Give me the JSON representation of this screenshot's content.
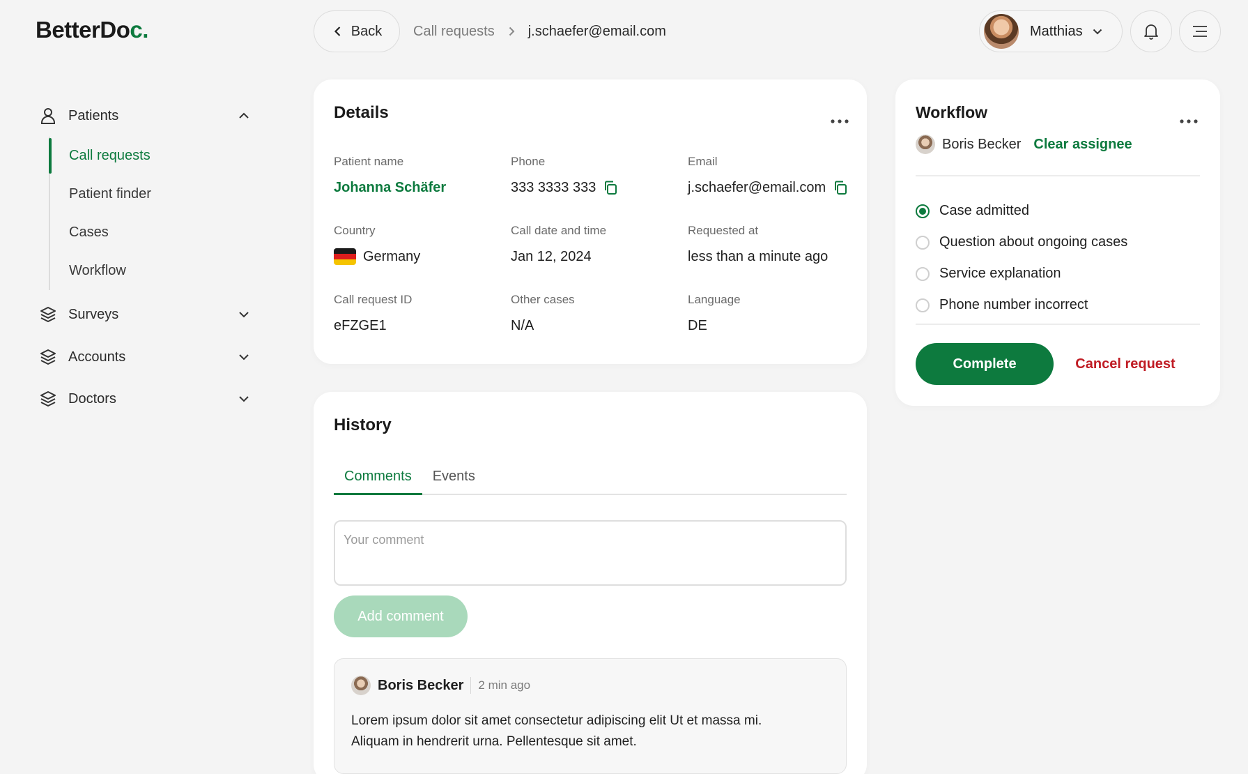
{
  "logo": {
    "text_main": "BetterDo",
    "text_accent": "c."
  },
  "topbar": {
    "back_label": "Back",
    "breadcrumb": {
      "parent": "Call requests",
      "current": "j.schaefer@email.com"
    },
    "user_name": "Matthias"
  },
  "sidebar": {
    "patients": {
      "label": "Patients",
      "items": [
        {
          "label": "Call requests",
          "active": true
        },
        {
          "label": "Patient finder"
        },
        {
          "label": "Cases"
        },
        {
          "label": "Workflow"
        }
      ]
    },
    "groups": [
      {
        "label": "Surveys"
      },
      {
        "label": "Accounts"
      },
      {
        "label": "Doctors"
      }
    ]
  },
  "details": {
    "title": "Details",
    "patient_name": {
      "label": "Patient name",
      "value": "Johanna Schäfer"
    },
    "phone": {
      "label": "Phone",
      "value": "333 3333 333"
    },
    "email": {
      "label": "Email",
      "value": "j.schaefer@email.com"
    },
    "country": {
      "label": "Country",
      "value": "Germany"
    },
    "call_date": {
      "label": "Call date and time",
      "value": "Jan 12, 2024"
    },
    "requested_at": {
      "label": "Requested at",
      "value": "less than a minute ago"
    },
    "call_request_id": {
      "label": "Call request ID",
      "value": "eFZGE1"
    },
    "other_cases": {
      "label": "Other cases",
      "value": "N/A"
    },
    "language": {
      "label": "Language",
      "value": "DE"
    }
  },
  "history": {
    "title": "History",
    "tabs": [
      {
        "label": "Comments",
        "active": true
      },
      {
        "label": "Events"
      }
    ],
    "comment_placeholder": "Your comment",
    "add_comment_label": "Add comment",
    "comments": [
      {
        "author": "Boris Becker",
        "time": "2 min ago",
        "text": "Lorem ipsum dolor sit amet consectetur adipiscing elit Ut et massa mi. Aliquam in hendrerit urna. Pellentesque sit amet."
      }
    ]
  },
  "workflow": {
    "title": "Workflow",
    "assignee": "Boris Becker",
    "clear_assignee_label": "Clear assignee",
    "options": [
      {
        "label": "Case admitted",
        "checked": true
      },
      {
        "label": "Question about ongoing cases"
      },
      {
        "label": "Service explanation"
      },
      {
        "label": "Phone number incorrect"
      }
    ],
    "complete_label": "Complete",
    "cancel_label": "Cancel request"
  },
  "colors": {
    "accent": "#0d7a3e",
    "danger": "#c01c24",
    "background": "#f4f4f4",
    "card": "#ffffff"
  }
}
